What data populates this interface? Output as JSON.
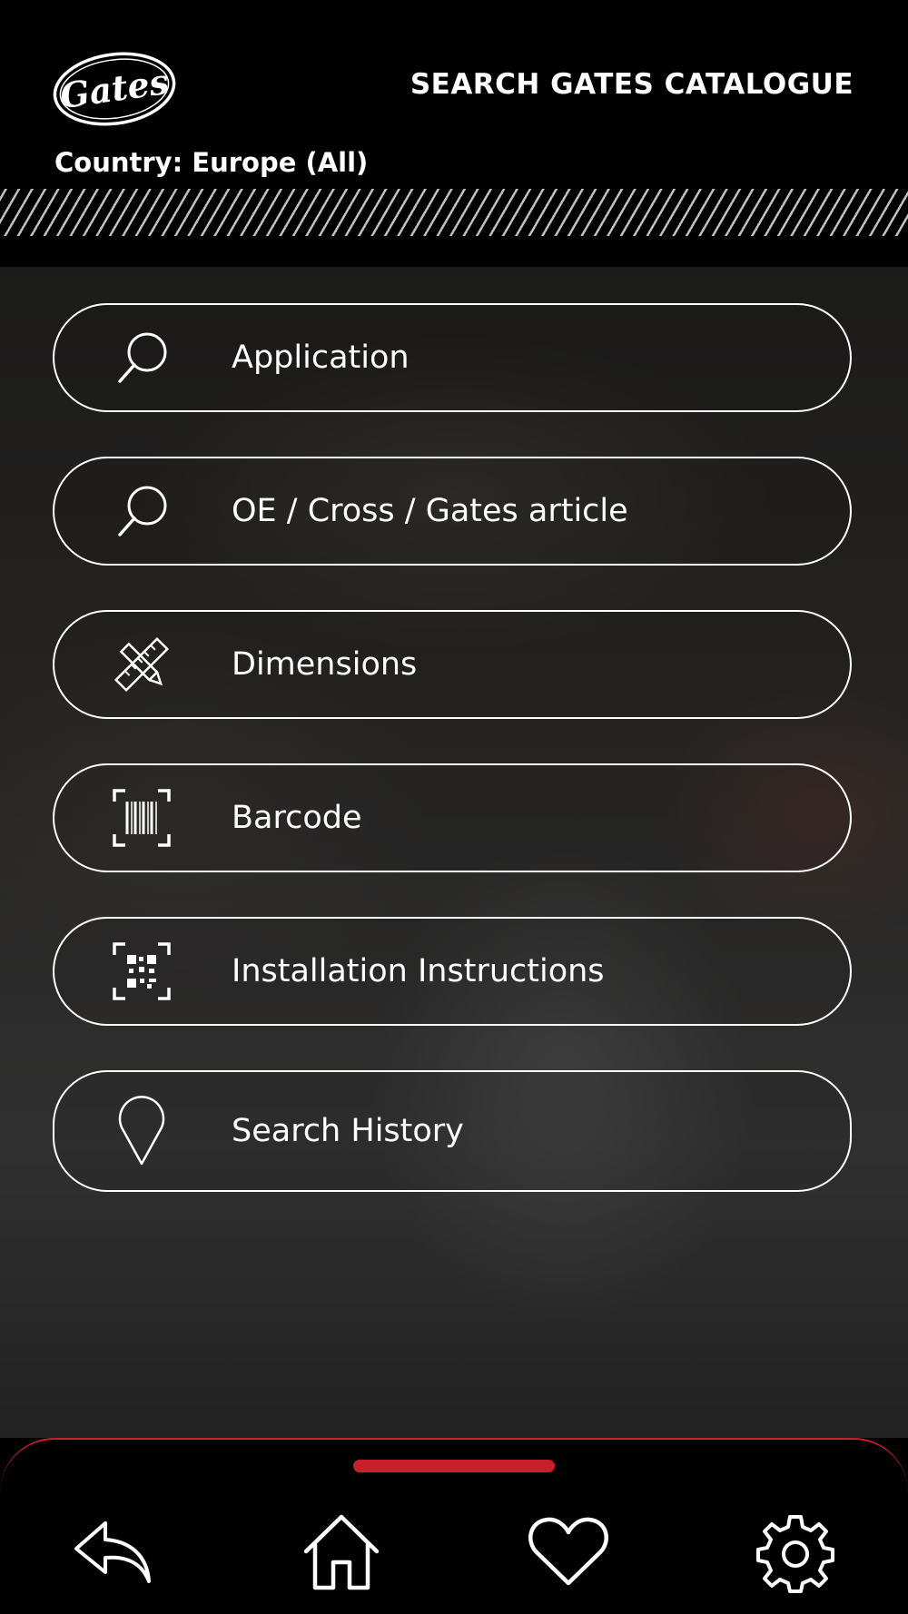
{
  "header": {
    "logo_text": "Gates",
    "title": "SEARCH GATES CATALOGUE",
    "country": "Country: Europe (All)"
  },
  "menu": {
    "items": [
      {
        "label": "Application",
        "icon": "search-icon"
      },
      {
        "label": "OE / Cross / Gates article",
        "icon": "search-icon"
      },
      {
        "label": "Dimensions",
        "icon": "ruler-pencil-icon"
      },
      {
        "label": "Barcode",
        "icon": "barcode-scan-icon"
      },
      {
        "label": "Installation Instructions",
        "icon": "qr-code-scan-icon"
      },
      {
        "label": "Search History",
        "icon": "location-pin-icon"
      }
    ]
  },
  "bottom_nav": {
    "items": [
      {
        "icon": "back-arrow-icon"
      },
      {
        "icon": "home-icon"
      },
      {
        "icon": "heart-icon"
      },
      {
        "icon": "gear-icon"
      }
    ]
  },
  "colors": {
    "accent": "#c8202a",
    "background": "#000000",
    "text": "#ffffff"
  }
}
